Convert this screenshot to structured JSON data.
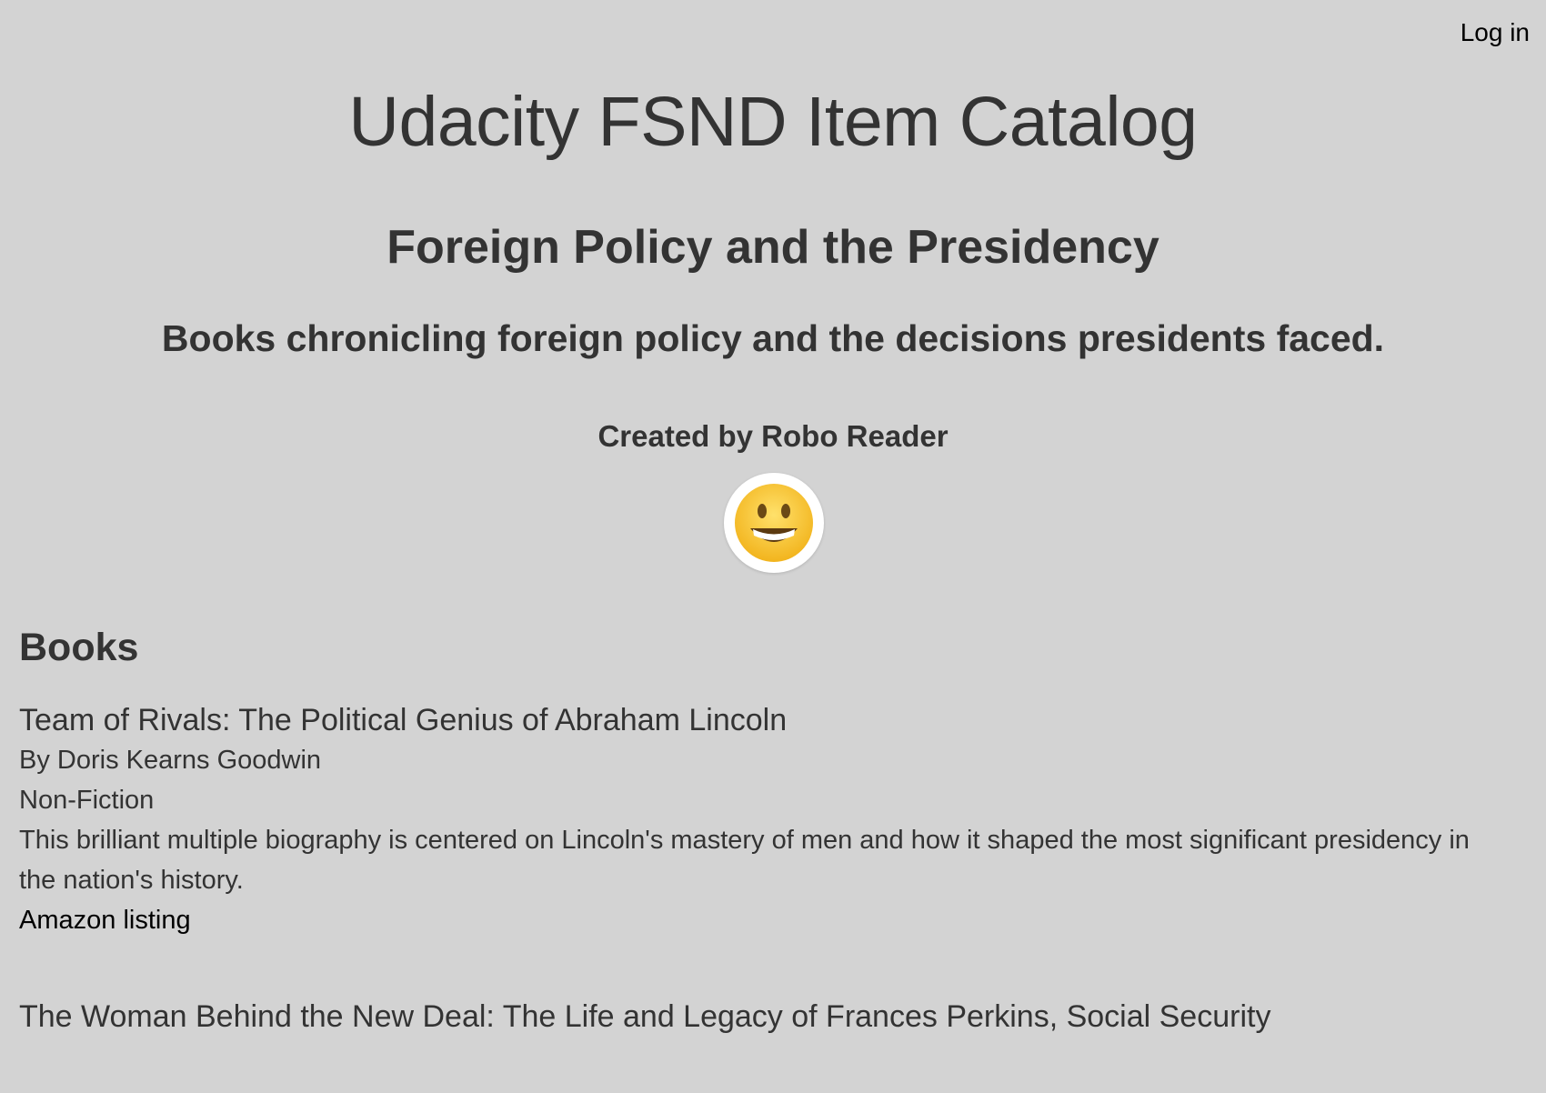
{
  "header": {
    "login_label": "Log in"
  },
  "site": {
    "title": "Udacity FSND Item Catalog"
  },
  "category": {
    "name": "Foreign Policy and the Presidency",
    "description": "Books chronicling foreign policy and the decisions presidents faced.",
    "creator_line": "Created by Robo Reader",
    "avatar_icon": "grinning-face-icon"
  },
  "books_section": {
    "heading": "Books",
    "items": [
      {
        "title": "Team of Rivals: The Political Genius of Abraham Lincoln",
        "author": "By Doris Kearns Goodwin",
        "genre": "Non-Fiction",
        "summary": "This brilliant multiple biography is centered on Lincoln's mastery of men and how it shaped the most significant presidency in the nation's history.",
        "link_label": "Amazon listing"
      },
      {
        "title": "The Woman Behind the New Deal: The Life and Legacy of Frances Perkins, Social Security"
      }
    ]
  },
  "colors": {
    "background": "#d3d3d3",
    "text": "#333333",
    "link": "#000000",
    "avatar_bg": "#ffffff",
    "emoji_face": "#f8c11f"
  }
}
